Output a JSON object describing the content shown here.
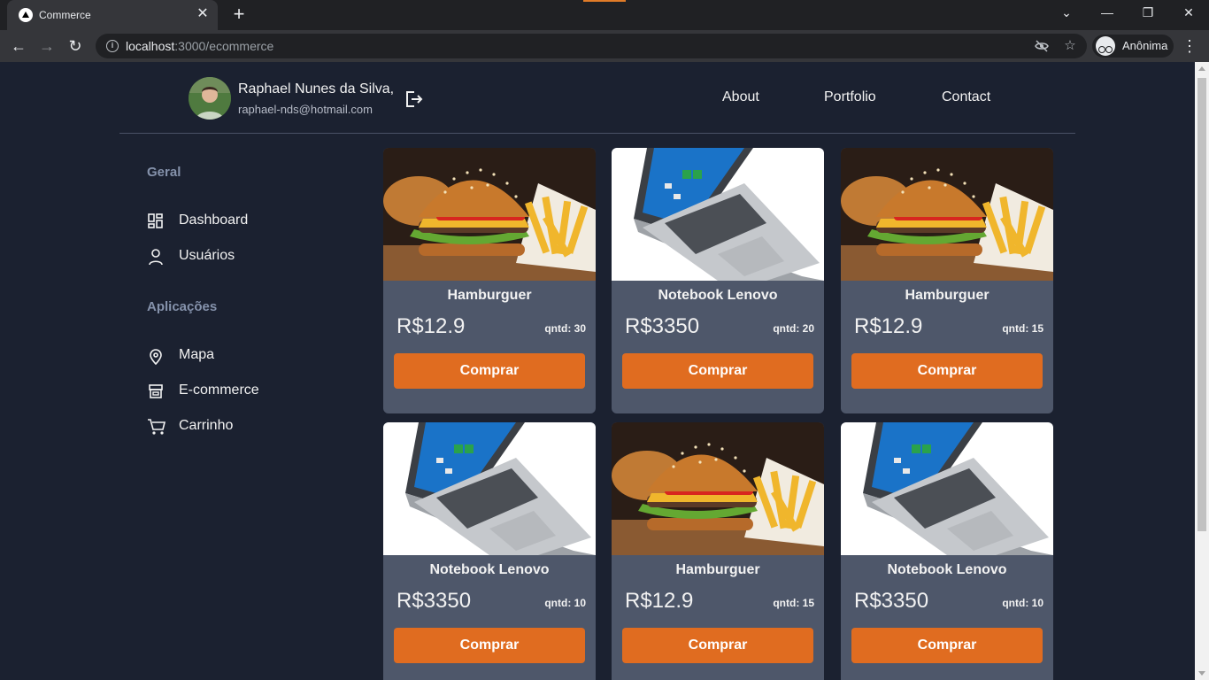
{
  "browser": {
    "tab_title": "Commerce",
    "url_host": "localhost",
    "url_rest": ":3000/ecommerce",
    "profile_label": "Anônima"
  },
  "header": {
    "user_name": "Raphael Nunes da Silva,",
    "user_email": "raphael-nds@hotmail.com",
    "nav": [
      "About",
      "Portfolio",
      "Contact"
    ]
  },
  "sidebar": {
    "section_1": "Geral",
    "items_1": [
      "Dashboard",
      "Usuários"
    ],
    "section_2": "Aplicações",
    "items_2": [
      "Mapa",
      "E-commerce",
      "Carrinho"
    ]
  },
  "products": [
    {
      "name": "Hamburguer",
      "price": "R$12.9",
      "qty": "qntd: 30",
      "button": "Comprar",
      "image": "burger"
    },
    {
      "name": "Notebook Lenovo",
      "price": "R$3350",
      "qty": "qntd: 20",
      "button": "Comprar",
      "image": "laptop"
    },
    {
      "name": "Hamburguer",
      "price": "R$12.9",
      "qty": "qntd: 15",
      "button": "Comprar",
      "image": "burger"
    },
    {
      "name": "Notebook Lenovo",
      "price": "R$3350",
      "qty": "qntd: 10",
      "button": "Comprar",
      "image": "laptop"
    },
    {
      "name": "Hamburguer",
      "price": "R$12.9",
      "qty": "qntd: 15",
      "button": "Comprar",
      "image": "burger"
    },
    {
      "name": "Notebook Lenovo",
      "price": "R$3350",
      "qty": "qntd: 10",
      "button": "Comprar",
      "image": "laptop"
    }
  ],
  "colors": {
    "page_bg": "#1b2130",
    "card_bg": "#4e576a",
    "accent": "#e06c20"
  }
}
